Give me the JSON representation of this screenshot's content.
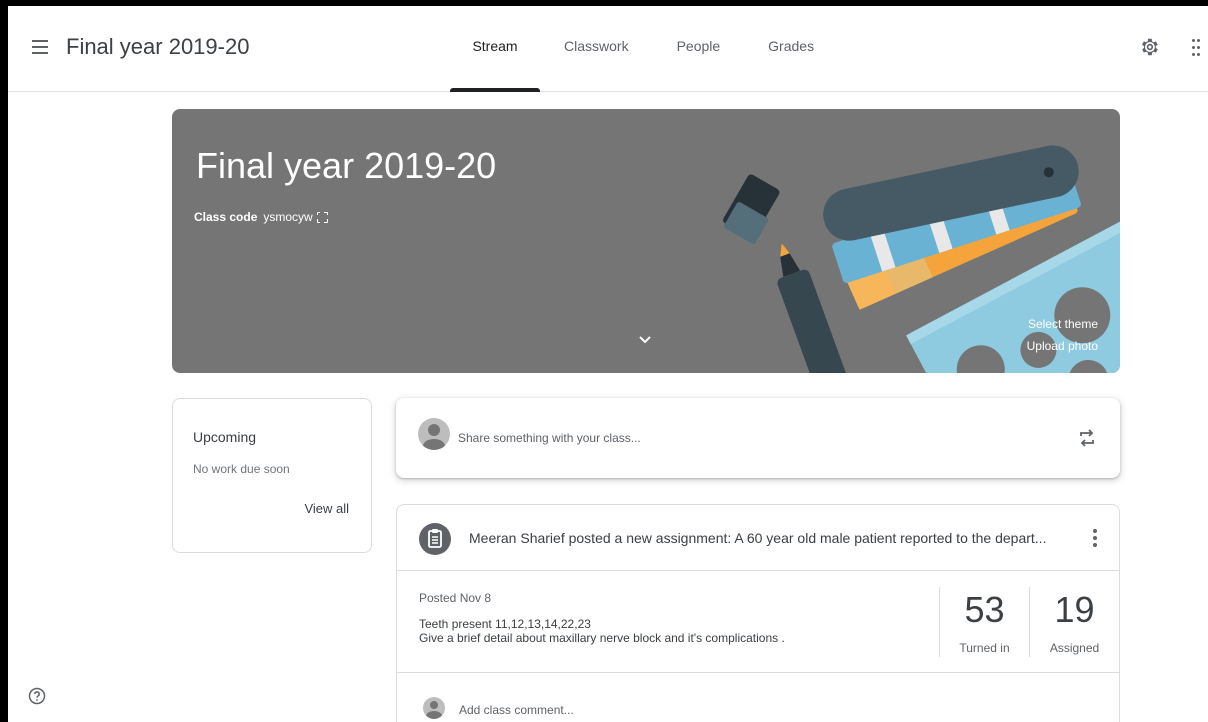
{
  "header": {
    "title": "Final year 2019-20",
    "tabs": [
      {
        "label": "Stream",
        "active": true
      },
      {
        "label": "Classwork",
        "active": false
      },
      {
        "label": "People",
        "active": false
      },
      {
        "label": "Grades",
        "active": false
      }
    ],
    "icons": [
      "menu-icon",
      "gear-icon",
      "apps-grid-icon"
    ]
  },
  "banner": {
    "title": "Final year 2019-20",
    "class_code_label": "Class code",
    "class_code": "ysmocyw",
    "select_theme": "Select theme",
    "upload_photo": "Upload photo",
    "background_color": "#757575"
  },
  "upcoming": {
    "title": "Upcoming",
    "empty_text": "No work due soon",
    "view_all": "View all"
  },
  "share": {
    "placeholder": "Share something with your class..."
  },
  "post": {
    "title": "Meeran Sharief posted a new assignment: A 60 year old male patient reported to the depart...",
    "posted": "Posted Nov 8",
    "line1": "Teeth present 11,12,13,14,22,23",
    "line2": "Give a brief detail about maxillary nerve block and it's complications .",
    "turned_in": {
      "count": "53",
      "label": "Turned in"
    },
    "assigned": {
      "count": "19",
      "label": "Assigned"
    },
    "comment_placeholder": "Add class comment..."
  },
  "colors": {
    "accent": "#202124",
    "banner": "#757575",
    "border": "#dadce0"
  }
}
